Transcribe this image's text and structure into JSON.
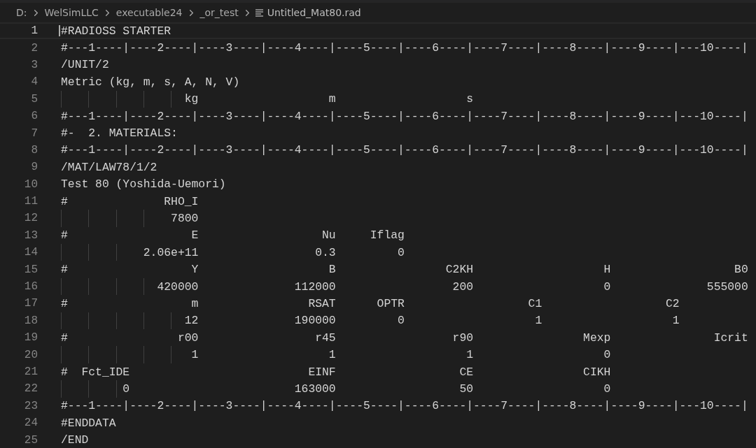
{
  "breadcrumb": [
    {
      "label": "D:",
      "kind": "folder"
    },
    {
      "label": "WelSimLLC",
      "kind": "folder"
    },
    {
      "label": "executable24",
      "kind": "folder"
    },
    {
      "label": "_or_test",
      "kind": "folder"
    },
    {
      "label": "Untitled_Mat80.rad",
      "kind": "file"
    }
  ],
  "editor": {
    "lines": [
      {
        "number": "1",
        "text": "#RADIOSS STARTER",
        "current": true
      },
      {
        "number": "2",
        "text": "#---1----|----2----|----3----|----4----|----5----|----6----|----7----|----8----|----9----|---10----|",
        "current": false
      },
      {
        "number": "3",
        "text": "/UNIT/2",
        "current": false
      },
      {
        "number": "4",
        "text": "Metric (kg, m, s, A, N, V)",
        "current": false
      },
      {
        "number": "5",
        "text": "                  kg                   m                   s",
        "current": false
      },
      {
        "number": "6",
        "text": "#---1----|----2----|----3----|----4----|----5----|----6----|----7----|----8----|----9----|---10----|",
        "current": false
      },
      {
        "number": "7",
        "text": "#-  2. MATERIALS:",
        "current": false
      },
      {
        "number": "8",
        "text": "#---1----|----2----|----3----|----4----|----5----|----6----|----7----|----8----|----9----|---10----|",
        "current": false
      },
      {
        "number": "9",
        "text": "/MAT/LAW78/1/2",
        "current": false
      },
      {
        "number": "10",
        "text": "Test 80 (Yoshida-Uemori)",
        "current": false
      },
      {
        "number": "11",
        "text": "#              RHO_I",
        "current": false
      },
      {
        "number": "12",
        "text": "                7800",
        "current": false
      },
      {
        "number": "13",
        "text": "#                  E                  Nu     Iflag",
        "current": false
      },
      {
        "number": "14",
        "text": "            2.06e+11                 0.3         0",
        "current": false
      },
      {
        "number": "15",
        "text": "#                  Y                   B                C2KH                   H                  B0",
        "current": false
      },
      {
        "number": "16",
        "text": "              420000              112000                 200                   0              555000",
        "current": false
      },
      {
        "number": "17",
        "text": "#                  m                RSAT      OPTR                  C1                  C2",
        "current": false
      },
      {
        "number": "18",
        "text": "                  12              190000         0                   1                   1",
        "current": false
      },
      {
        "number": "19",
        "text": "#                r00                 r45                 r90                Mexp               Icrit",
        "current": false
      },
      {
        "number": "20",
        "text": "                   1                   1                   1                   0",
        "current": false
      },
      {
        "number": "21",
        "text": "#  Fct_IDE                          EINF                  CE                CIKH",
        "current": false
      },
      {
        "number": "22",
        "text": "         0                        163000                  50                   0",
        "current": false
      },
      {
        "number": "23",
        "text": "#---1----|----2----|----3----|----4----|----5----|----6----|----7----|----8----|----9----|---10----|",
        "current": false
      },
      {
        "number": "24",
        "text": "#ENDDATA",
        "current": false
      },
      {
        "number": "25",
        "text": "/END",
        "current": false
      }
    ]
  }
}
